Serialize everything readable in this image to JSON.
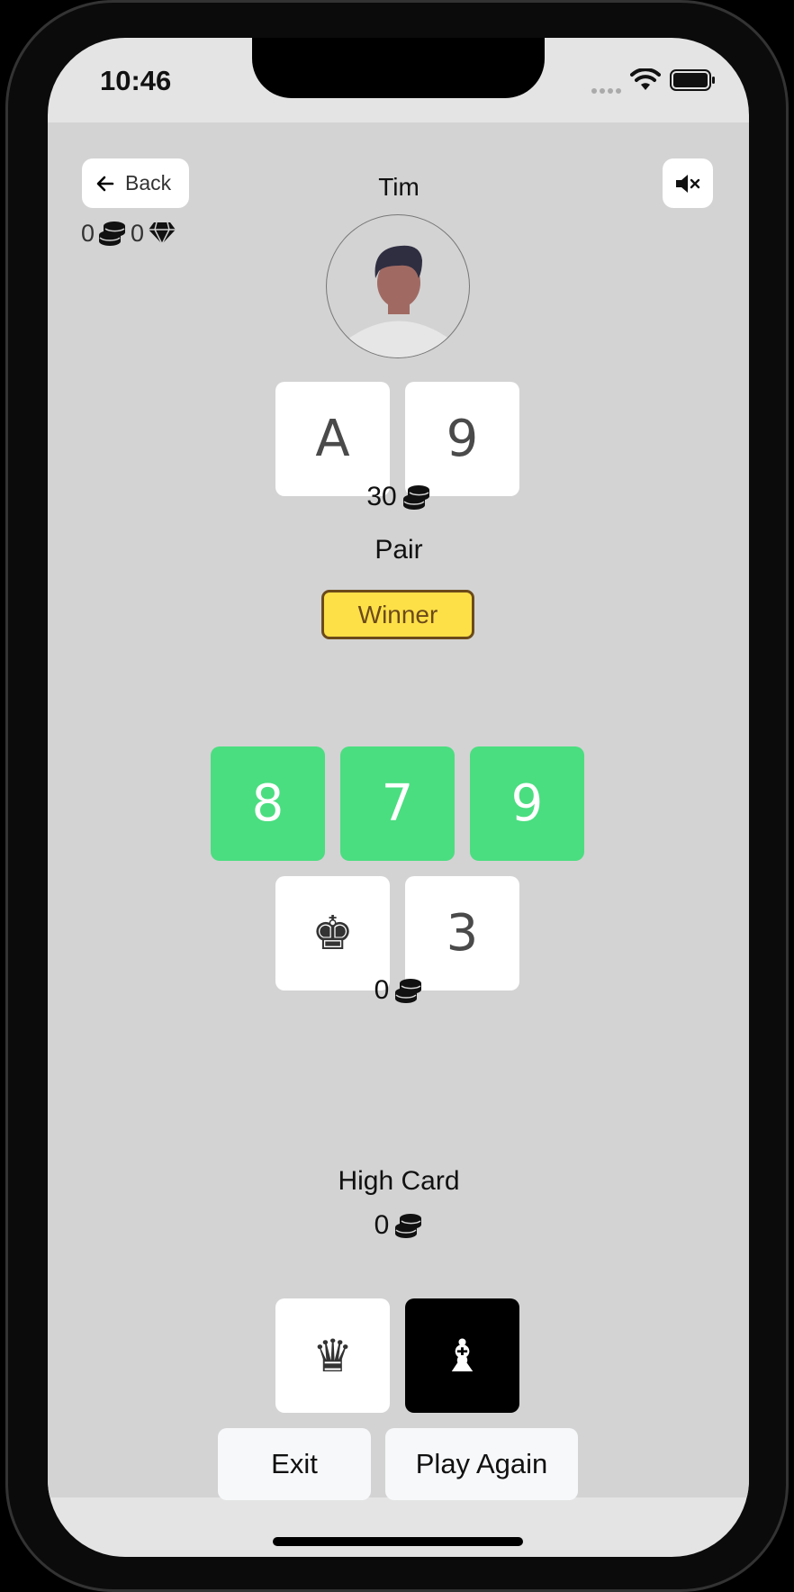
{
  "status": {
    "time": "10:46"
  },
  "header": {
    "back_label": "Back",
    "player_name": "Tim",
    "coins": "0",
    "gems": "0"
  },
  "opponent": {
    "cards": [
      "A",
      "9"
    ],
    "bet": "30",
    "hand": "Pair",
    "badge": "Winner"
  },
  "board": {
    "cards": [
      "8",
      "7",
      "9"
    ],
    "accent_color": "#4ade80"
  },
  "me": {
    "cards": [
      "♚",
      "3"
    ],
    "bet": "0",
    "hand": "High Card",
    "pot": "0"
  },
  "picker": {
    "cards": [
      "♛",
      "♝"
    ]
  },
  "actions": {
    "exit_label": "Exit",
    "play_again_label": "Play Again"
  },
  "colors": {
    "winner_bg": "#fde047",
    "winner_border": "#6b4a1a"
  }
}
